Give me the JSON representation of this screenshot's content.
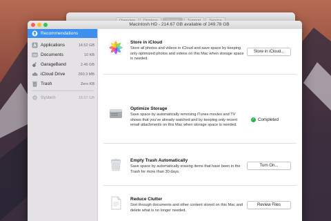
{
  "back_window": {
    "tabs": [
      "Overview",
      "Displays",
      "Storage",
      "Support",
      "Service"
    ],
    "active_tab_index": 2
  },
  "window": {
    "title": "Macintosh HD - 214.67 GB available of 249.78 GB"
  },
  "sidebar": {
    "items": [
      {
        "label": "Recommendations",
        "size": "",
        "icon": "lightbulb-icon"
      },
      {
        "label": "Applications",
        "size": "14.52 GB",
        "icon": "applications-icon"
      },
      {
        "label": "Documents",
        "size": "10 KB",
        "icon": "documents-icon"
      },
      {
        "label": "GarageBand",
        "size": "2.46 GB",
        "icon": "guitar-icon"
      },
      {
        "label": "iCloud Drive",
        "size": "260.3 MB",
        "icon": "cloud-icon"
      },
      {
        "label": "Trash",
        "size": "Zero KB",
        "icon": "trash-icon"
      },
      {
        "label": "System",
        "size": "18.07 GB",
        "icon": "gear-icon"
      }
    ]
  },
  "sections": [
    {
      "title": "Store in iCloud",
      "description": "Store all photos and videos in iCloud and save space by keeping only optimized photos and videos on this Mac when storage space is needed.",
      "button": "Store in iCloud...",
      "icon": "photos-icon"
    },
    {
      "title": "Optimize Storage",
      "description": "Save space by automatically removing iTunes movies and TV shows that you've already watched and by keeping only recent email attachments on this Mac when storage space is needed.",
      "status": "Completed",
      "icon": "hard-drive-icon"
    },
    {
      "title": "Empty Trash Automatically",
      "description": "Save space by automatically erasing items that have been in the Trash for more than 30 days.",
      "button": "Turn On...",
      "icon": "trash-can-icon"
    },
    {
      "title": "Reduce Clutter",
      "description": "Sort through documents and other content stored on this Mac and delete what is no longer needed.",
      "button": "Review Files",
      "icon": "document-icon"
    }
  ],
  "colors": {
    "selection": "#3d8ff0",
    "completed_check": "#27b34b"
  }
}
